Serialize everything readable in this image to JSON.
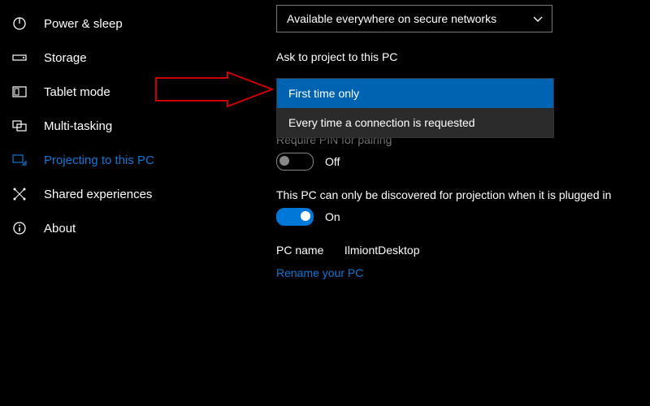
{
  "sidebar": {
    "items": [
      {
        "label": "Power & sleep",
        "icon": "power-icon",
        "active": false
      },
      {
        "label": "Storage",
        "icon": "storage-icon",
        "active": false
      },
      {
        "label": "Tablet mode",
        "icon": "tablet-icon",
        "active": false
      },
      {
        "label": "Multi-tasking",
        "icon": "multitask-icon",
        "active": false
      },
      {
        "label": "Projecting to this PC",
        "icon": "project-icon",
        "active": true
      },
      {
        "label": "Shared experiences",
        "icon": "shared-icon",
        "active": false
      },
      {
        "label": "About",
        "icon": "about-icon",
        "active": false
      }
    ]
  },
  "main": {
    "availability_dropdown": {
      "selected": "Available everywhere on secure networks"
    },
    "ask_label": "Ask to project to this PC",
    "ask_options": [
      {
        "label": "First time only",
        "selected": true
      },
      {
        "label": "Every time a connection is requested",
        "selected": false
      }
    ],
    "pin_label": "Require PIN for pairing",
    "pin_toggle": {
      "state": "off",
      "text": "Off"
    },
    "discover_label": "This PC can only be discovered for projection when it is plugged in",
    "discover_toggle": {
      "state": "on",
      "text": "On"
    },
    "pcname_key": "PC name",
    "pcname_value": "IlmiontDesktop",
    "rename_link": "Rename your PC"
  },
  "annotation": {
    "type": "arrow",
    "color": "#d00000"
  }
}
